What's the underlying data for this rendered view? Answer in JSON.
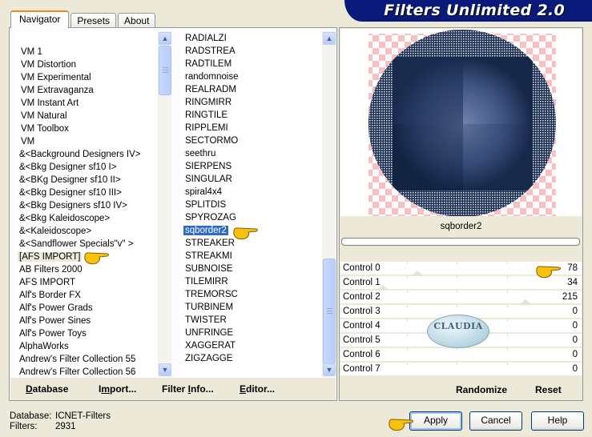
{
  "app": {
    "title": "Filters Unlimited 2.0"
  },
  "tabs": [
    {
      "label": "Navigator",
      "active": true
    },
    {
      "label": "Presets",
      "active": false
    },
    {
      "label": "About",
      "active": false
    }
  ],
  "categories": {
    "items": [
      "VM 1",
      "VM Distortion",
      "VM Experimental",
      "VM Extravaganza",
      "VM Instant Art",
      "VM Natural",
      "VM Toolbox",
      "VM",
      "&<Background Designers IV>",
      "&<Bkg Designer sf10 I>",
      "&<BKg Designer sf10 II>",
      "&<Bkg Designer sf10 III>",
      "&<Bkg Designers sf10 IV>",
      "&<Bkg Kaleidoscope>",
      "&<Kaleidoscope>",
      "&<Sandflower Specials\"v\" >",
      "[AFS IMPORT]",
      "AB Filters 2000",
      "AFS IMPORT",
      "Alf's Border FX",
      "Alf's Power Grads",
      "Alf's Power Sines",
      "Alf's Power Toys",
      "AlphaWorks",
      "Andrew's Filter Collection 55",
      "Andrew's Filter Collection 56"
    ],
    "selected": "[AFS IMPORT]"
  },
  "filters": {
    "items": [
      "RADIALZI",
      "RADSTREA",
      "RADTILEM",
      "randomnoise",
      "REALRADM",
      "RINGMIRR",
      "RINGTILE",
      "RIPPLEMI",
      "SECTORMO",
      "seethru",
      "SIERPENS",
      "SINGULAR",
      "spiral4x4",
      "SPLITDIS",
      "SPYROZAG",
      "sqborder2",
      "STREAKER",
      "STREAKMI",
      "SUBNOISE",
      "TILEMIRR",
      "TREMORSC",
      "TURBINEM",
      "TWISTER",
      "UNFRINGE",
      "XAGGERAT",
      "ZIGZAGGE"
    ],
    "selected": "sqborder2"
  },
  "left_buttons": {
    "database": {
      "label_pre": "",
      "ul": "D",
      "label_post": "atabase"
    },
    "import": {
      "label_pre": "I",
      "ul": "m",
      "label_post": "port..."
    },
    "filter_info": {
      "label_pre": "Filter ",
      "ul": "I",
      "label_post": "nfo..."
    },
    "editor": {
      "label_pre": "",
      "ul": "E",
      "label_post": "ditor..."
    }
  },
  "preview": {
    "filter_name": "sqborder2",
    "progress": 0
  },
  "controls": [
    {
      "label": "Control 0",
      "value": 78
    },
    {
      "label": "Control 1",
      "value": 34
    },
    {
      "label": "Control 2",
      "value": 215
    },
    {
      "label": "Control 3",
      "value": 0
    },
    {
      "label": "Control 4",
      "value": 0
    },
    {
      "label": "Control 5",
      "value": 0
    },
    {
      "label": "Control 6",
      "value": 0
    },
    {
      "label": "Control 7",
      "value": 0
    }
  ],
  "control_range": [
    0,
    255
  ],
  "right_buttons": {
    "randomize": "Randomize",
    "reset": "Reset"
  },
  "status": {
    "database_label": "Database:",
    "database_value": "ICNET-Filters",
    "filters_label": "Filters:",
    "filters_value": "2931"
  },
  "dialog_buttons": {
    "apply": "Apply",
    "cancel": "Cancel",
    "help": "Help"
  },
  "watermark": {
    "text": "CLAUDIA"
  },
  "colors": {
    "banner": "#0a1a7a",
    "selection": "#316ac5",
    "tab_accent": "#e68b2c"
  }
}
